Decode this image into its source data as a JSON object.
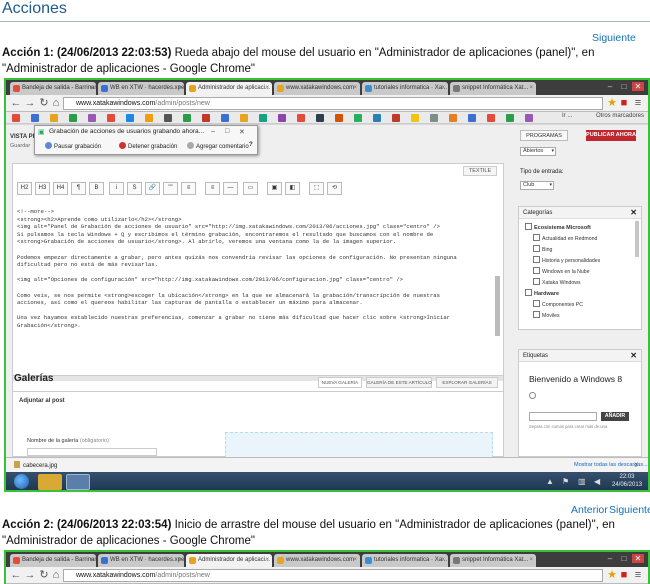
{
  "report": {
    "title": "Acciones",
    "action1": {
      "nav_next": "Siguiente",
      "heading": "Acción 1: (24/06/2013 22:03:53)",
      "description": " Rueda abajo del mouse del usuario en \"Administrador de aplicaciones (panel)\", en \"Administrador de aplicaciones - Google Chrome\""
    },
    "action2": {
      "nav_prev": "Anterior",
      "nav_next": "Siguiente",
      "heading": "Acción 2: (24/06/2013 22:03:54)",
      "description": " Inicio de arrastre del mouse del usuario en \"Administrador de aplicaciones (panel)\", en \"Administrador de aplicaciones - Google Chrome\""
    }
  },
  "browser": {
    "tabs": [
      {
        "label": "Bandeja de salida - Barrinanvella...",
        "fav": "#e34b3b"
      },
      {
        "label": "WB en XTW · hacerdes.xpe...",
        "fav": "#3b6fd1"
      },
      {
        "label": "Administrador de aplicaci...",
        "fav": "#e8a31f",
        "active": true
      },
      {
        "label": "www.xatakawindows.com",
        "fav": "#e8a31f"
      },
      {
        "label": "tutoriales informatica · Xa...",
        "fav": "#3b8ed1"
      },
      {
        "label": "snippet Informática Xat...",
        "fav": "#777777"
      }
    ],
    "url_host": "www.xatakawindows.com",
    "url_path": "/admin/posts/new",
    "bookmark_text_left": "Ir ...",
    "bookmark_text_right": "Otros marcadores"
  },
  "recorder": {
    "title": "Grabación de acciones de usuarios grabando ahora...",
    "pause": "Pausar grabación",
    "stop": "Detener grabación",
    "comment": "Agregar comentario",
    "help": "?"
  },
  "admin": {
    "side_label": "VISTA PREV",
    "side_sub": "Guardar",
    "editor_mode": "TEXTILE",
    "quicktags": [
      "H2",
      "H3",
      "H4",
      "¶",
      "B",
      "i",
      "S",
      "🔗",
      "\"\"",
      "≡",
      "≡",
      "—",
      "▭",
      "▣",
      "◧",
      "⬚",
      "⟲"
    ],
    "code_lines": [
      "<!--more-->",
      "<strong><h2>Aprende como utilizarlo</h2></strong>",
      "<img alt=\"Panel de Grabación de acciones de usuario\" src=\"http://img.xatakawindows.com/2013/06/acciones.jpg\" class=\"centro\" />",
      "Si pulsamos la tecla Windows + Q y escribimos el término grabación, encontraremos el resultado que buscamos con el nombre de",
      "<strong>Grabación de acciones de usuario</strong>. Al abrirlo, veremos una ventana como la de la imagen superior.",
      "",
      "Podemos empezar directamente a grabar, pero antes quizás nos convendría revisar las opciones de configuración. No presentan ninguna",
      "dificultad pero no está de más revisarlas.",
      "",
      "<img alt=\"Opciones de configuración\" src=\"http://img.xatakawindows.com/2013/06/configuracion.jpg\" class=\"centro\" />",
      "",
      "Como veis, se nos permite <strong>escoger la ubicación</strong> en la que se almacenará la grabación/transcripción de nuestras",
      "acciones, así como el quereos habilitar las capturas de pantalla o establecer un máximo para almacenar.",
      "",
      "Una vez hayamos establecido nuestras preferencias, comenzar a grabar no tiene más dificultad que hacer clic sobre <strong>Iniciar",
      "Grabación</strong>."
    ],
    "gallery": {
      "title": "Galerías",
      "tabs": [
        "NUEVA GALERÍA",
        "GALERÍA DE ESTE ARTÍCULO",
        "EXPLORAR GALERÍAS"
      ],
      "adjust": "Adjuntar al post",
      "name_label": "Nombre de la galería",
      "required": "(obligatorio)"
    },
    "sidebar": {
      "btn_programs": "PROGRAMAS",
      "btn_publish": "PUBLICAR AHORA",
      "select_top": "Abiertos",
      "entry_type_label": "Tipo de entrada:",
      "entry_type_value": "Club",
      "categories_title": "Categorías",
      "categories": [
        {
          "label": "Ecosistema Microsoft",
          "main": true
        },
        {
          "label": "Actualidad en Redmond"
        },
        {
          "label": "Bing"
        },
        {
          "label": "Historia y personalidades"
        },
        {
          "label": "Windows en la Nube"
        },
        {
          "label": "Xataka Windows"
        },
        {
          "label": "Hardware",
          "main": true
        },
        {
          "label": "Componentes PC"
        },
        {
          "label": "Móviles"
        }
      ],
      "tags_title": "Etiquetas",
      "tags_entry": "Bienvenido a Windows 8",
      "add_btn": "AÑADIR",
      "tags_hint": "Separa con comas para crear más de una"
    },
    "download": {
      "file": "cabecera.jpg",
      "show_all": "Mostrar todas las descargas...",
      "close": "×"
    },
    "clock": {
      "time": "22:03",
      "date": "24/06/2013"
    }
  },
  "colors": {
    "accent_link": "#1570b8",
    "frame_green": "#38c238",
    "publish_red": "#c0262d"
  }
}
